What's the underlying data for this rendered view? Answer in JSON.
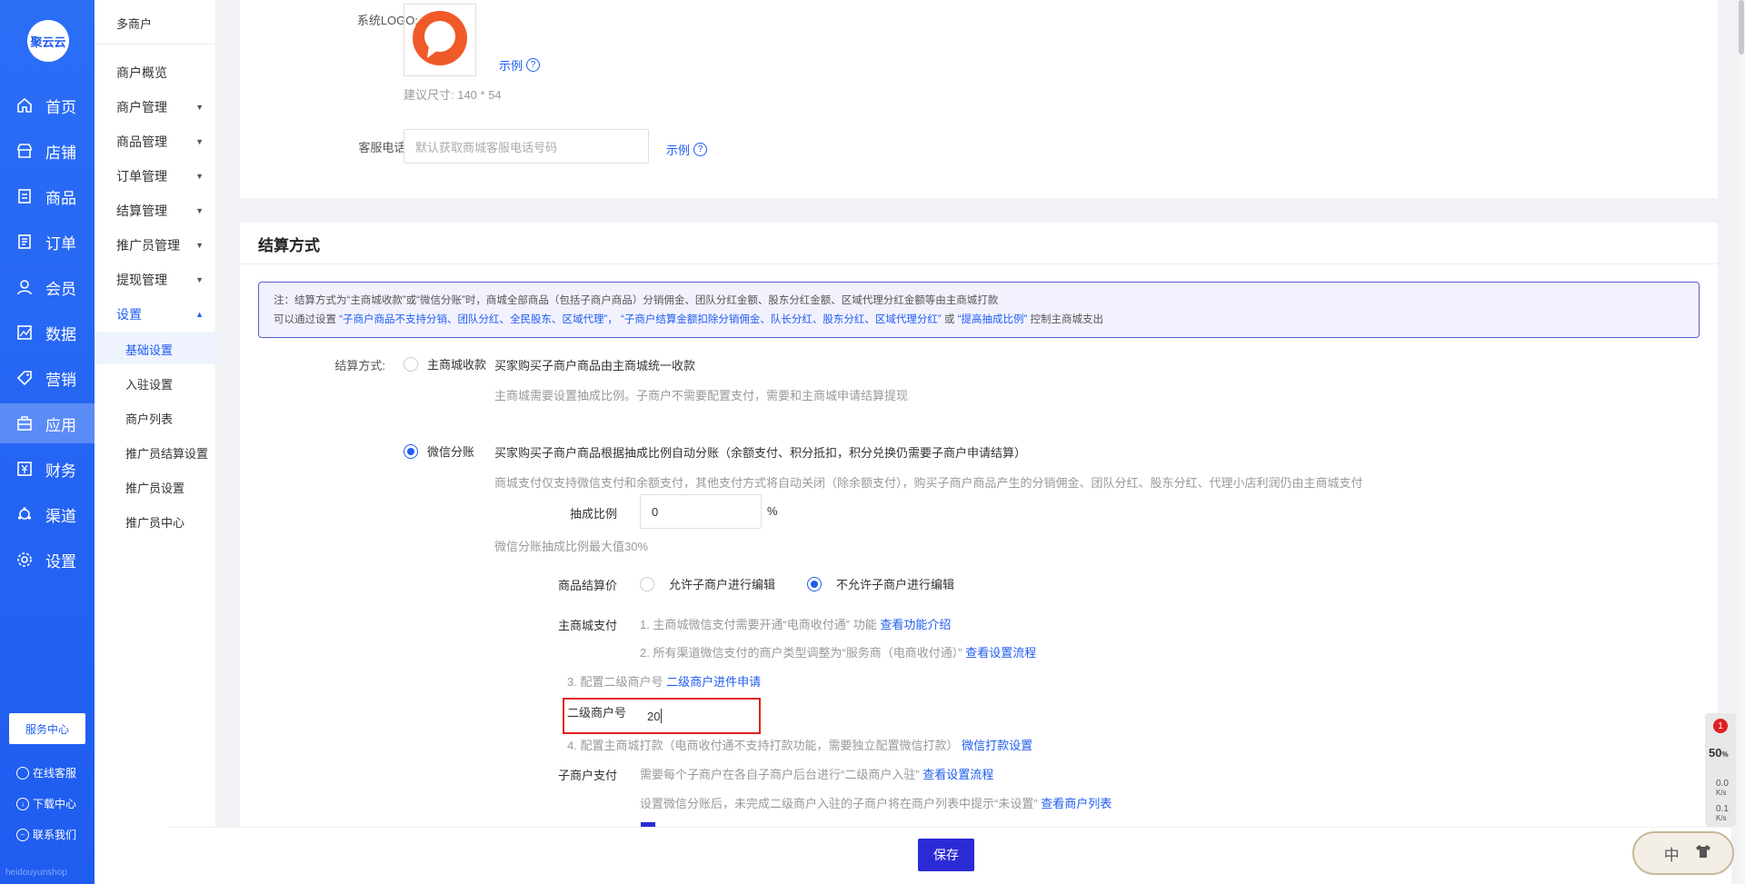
{
  "brand": {
    "logo_text": "聚云云",
    "watermark": "heidouyunshop"
  },
  "nav": [
    {
      "label": "首页",
      "icon": "home-icon"
    },
    {
      "label": "店铺",
      "icon": "store-icon"
    },
    {
      "label": "商品",
      "icon": "goods-icon"
    },
    {
      "label": "订单",
      "icon": "order-icon"
    },
    {
      "label": "会员",
      "icon": "user-icon"
    },
    {
      "label": "数据",
      "icon": "chart-icon"
    },
    {
      "label": "营销",
      "icon": "tag-icon"
    },
    {
      "label": "应用",
      "icon": "app-icon"
    },
    {
      "label": "财务",
      "icon": "finance-icon"
    },
    {
      "label": "渠道",
      "icon": "channel-icon"
    },
    {
      "label": "设置",
      "icon": "gear-icon"
    }
  ],
  "nav_bottom": {
    "service_center": "服务中心",
    "online_service": "在线客服",
    "download_center": "下载中心",
    "contact_us": "联系我们"
  },
  "subnav": {
    "title": "多商户",
    "items": [
      "商户概览",
      "商户管理",
      "商品管理",
      "订单管理",
      "结算管理",
      "推广员管理",
      "提现管理",
      "设置"
    ],
    "children": [
      "基础设置",
      "入驻设置",
      "商户列表",
      "推广员结算设置",
      "推广员设置",
      "推广员中心"
    ]
  },
  "logo_section": {
    "label": "系统LOGO:",
    "example": "示例",
    "hint": "建议尺寸: 140 * 54"
  },
  "phone_section": {
    "label": "客服电话:",
    "placeholder": "默认获取商城客服电话号码",
    "example": "示例"
  },
  "settlement": {
    "title": "结算方式",
    "notice_line1": "注：结算方式为“主商城收款”或“微信分账”时，商城全部商品（包括子商户商品）分销佣金、团队分红金额、股东分红金额、区域代理分红金额等由主商城打款",
    "notice_line2_prefix": "可以通过设置",
    "notice_link1": "“子商户商品不支持分销、团队分红、全民股东、区域代理”，",
    "notice_link2": "“子商户结算金额扣除分销佣金、队长分红、股东分红、区域代理分红”",
    "notice_or": "或",
    "notice_link3": "“提高抽成比例”",
    "notice_suffix": "控制主商城支出",
    "method_label": "结算方式:",
    "option1_label": "主商城收款",
    "option1_desc": "买家购买子商户商品由主商城统一收款",
    "option1_hint": "主商城需要设置抽成比例。子商户不需要配置支付，需要和主商城申请结算提现",
    "option2_label": "微信分账",
    "option2_desc": "买家购买子商户商品根据抽成比例自动分账（余额支付、积分抵扣，积分兑换仍需要子商户申请结算）",
    "option2_hint": "商城支付仅支持微信支付和余额支付，其他支付方式将自动关闭（除余额支付），购买子商户商品产生的分销佣金、团队分红、股东分红、代理小店利润仍由主商城支付",
    "ratio_label": "抽成比例",
    "ratio_value": "0",
    "ratio_unit": "%",
    "ratio_hint": "微信分账抽成比例最大值30%",
    "price_label": "商品结算价",
    "price_opt1": "允许子商户进行编辑",
    "price_opt2": "不允许子商户进行编辑",
    "main_pay_label": "主商城支付",
    "main_pay_1": "1. 主商城微信支付需要开通“电商收付通” 功能",
    "main_pay_1_link": "查看功能介绍",
    "main_pay_2": "2. 所有渠道微信支付的商户类型调整为“服务商（电商收付通）”",
    "main_pay_2_link": "查看设置流程",
    "main_pay_3": "3. 配置二级商户号",
    "main_pay_3_link": "二级商户进件申请",
    "sub_mch_label": "二级商户号",
    "sub_mch_value": "20",
    "main_pay_4": "4. 配置主商城打款（电商收付通不支持打款功能，需要独立配置微信打款）",
    "main_pay_4_link": "微信打款设置",
    "sub_pay_label": "子商户支付",
    "sub_pay_1": "需要每个子商户在各自子商户后台进行“二级商户入驻”",
    "sub_pay_1_link": "查看设置流程",
    "sub_pay_2": "设置微信分账后，未完成二级商户入驻的子商户将在商户列表中提示“未设置”",
    "sub_pay_2_link": "查看商户列表"
  },
  "footer": {
    "save": "保存"
  },
  "widget": {
    "badge": "1",
    "percent": "50",
    "percent_unit": "%",
    "up": "0.0",
    "down": "0.1",
    "speed_unit": "K/s"
  },
  "ime": {
    "lang": "中"
  }
}
